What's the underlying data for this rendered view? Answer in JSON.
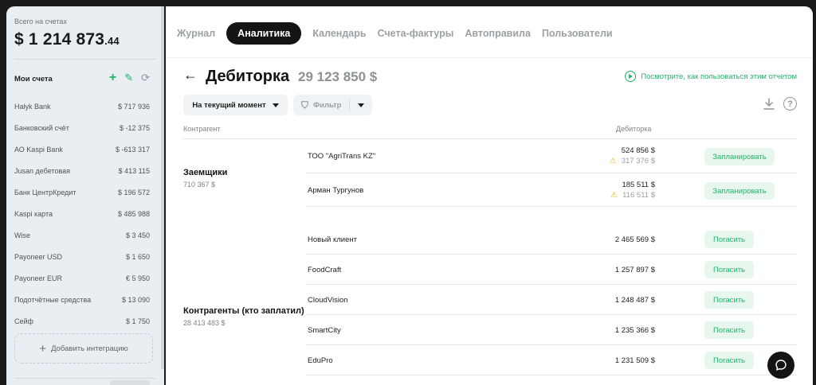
{
  "sidebar": {
    "total_label": "Всего на счетах",
    "total_main": "$ 1 214 873",
    "total_cents": ".44",
    "accounts_header": "Мои счета",
    "accounts": [
      {
        "name": "Halyk Bank",
        "amount": "$ 717 936"
      },
      {
        "name": "Банковский счёт",
        "amount": "$ -12 375"
      },
      {
        "name": "АО Kaspi Bank",
        "amount": "$ -613 317"
      },
      {
        "name": "Jusan дебетовая",
        "amount": "$ 413 115"
      },
      {
        "name": "Банк ЦентрКредит",
        "amount": "$ 196 572"
      },
      {
        "name": "Kaspi карта",
        "amount": "$ 485 988"
      },
      {
        "name": "Wise",
        "amount": "$ 3 450"
      },
      {
        "name": "Payoneer USD",
        "amount": "$ 1 650"
      },
      {
        "name": "Payoneer EUR",
        "amount": "€ 5 950"
      },
      {
        "name": "Подотчётные средства",
        "amount": "$ 13 090"
      },
      {
        "name": "Сейф",
        "amount": "$ 1 750"
      }
    ],
    "add_integration": "Добавить интеграцию"
  },
  "tabs": [
    {
      "label": "Журнал",
      "active": false
    },
    {
      "label": "Аналитика",
      "active": true
    },
    {
      "label": "Календарь",
      "active": false
    },
    {
      "label": "Счета-фактуры",
      "active": false
    },
    {
      "label": "Автоправила",
      "active": false
    },
    {
      "label": "Пользователи",
      "active": false
    }
  ],
  "report": {
    "title": "Дебиторка",
    "total": "29 123 850  $",
    "help_link": "Посмотрите, как пользоваться этим отчетом",
    "date_filter": "На текущий момент",
    "filter_label": "Фильтр",
    "col_contractor": "Контрагент",
    "col_debt": "Дебиторка"
  },
  "groups": [
    {
      "name": "Заемщики",
      "sum": "710 367  $",
      "rows": [
        {
          "name": "ТОО \"AgriTrans KZ\"",
          "amount": "524 856  $",
          "overdue": "317 376  $",
          "action": "Запланировать"
        },
        {
          "name": "Арман Тургунов",
          "amount": "185 511  $",
          "overdue": "116 511  $",
          "action": "Запланировать"
        }
      ]
    },
    {
      "name": "Контрагенты (кто заплатил)",
      "sum": "28 413 483  $",
      "rows": [
        {
          "name": "Новый клиент",
          "amount": "2 465 569  $",
          "action": "Погасить"
        },
        {
          "name": "FoodCraft",
          "amount": "1 257 897  $",
          "action": "Погасить"
        },
        {
          "name": "CloudVision",
          "amount": "1 248 487  $",
          "action": "Погасить"
        },
        {
          "name": "SmartCity",
          "amount": "1 235 366  $",
          "action": "Погасить"
        },
        {
          "name": "EduPro",
          "amount": "1 231 509  $",
          "action": "Погасить"
        }
      ]
    }
  ],
  "colors": {
    "accent": "#21b36b",
    "active_tab": "#141414",
    "warning": "#f0b429"
  }
}
